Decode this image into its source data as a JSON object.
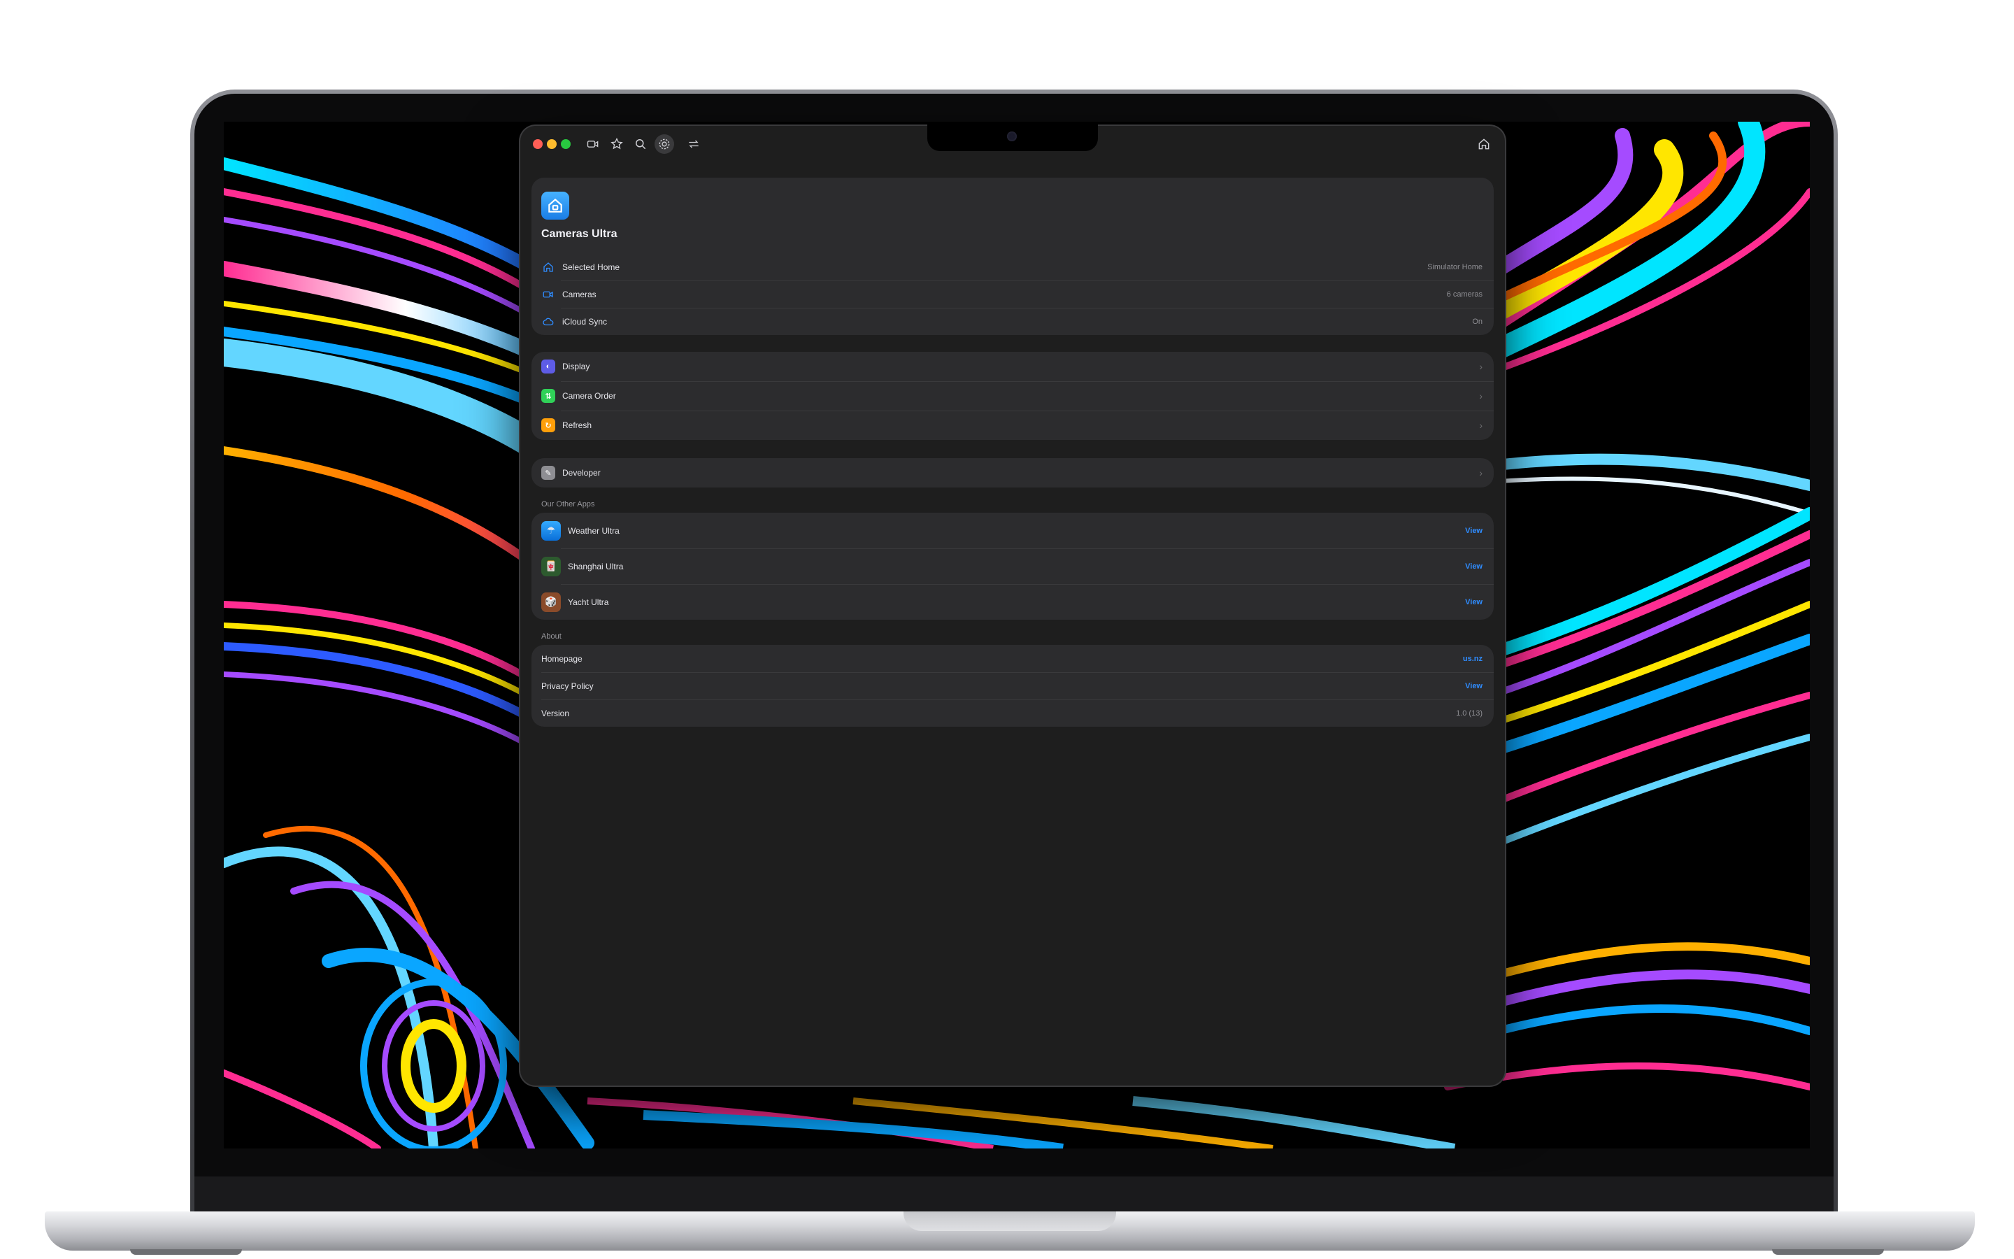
{
  "app": {
    "name": "Cameras Ultra",
    "accent": "#2f8cff"
  },
  "toolbar": {
    "icons": [
      "video-icon",
      "star-icon",
      "search-icon",
      "gear-icon",
      "swap-icon"
    ],
    "right_icon": "home-icon"
  },
  "summary": {
    "rows": [
      {
        "icon": "house-icon",
        "label": "Selected Home",
        "value": "Simulator Home"
      },
      {
        "icon": "video-icon",
        "label": "Cameras",
        "value": "6 cameras"
      },
      {
        "icon": "cloud-icon",
        "label": "iCloud Sync",
        "value": "On"
      }
    ]
  },
  "settings": {
    "rows": [
      {
        "icon": "display-icon",
        "label": "Display",
        "color": "#5e5ce6",
        "glyph": "◐"
      },
      {
        "icon": "order-icon",
        "label": "Camera Order",
        "color": "#30d158",
        "glyph": "⇅"
      },
      {
        "icon": "refresh-icon",
        "label": "Refresh",
        "color": "#ff9f0a",
        "glyph": "↻"
      }
    ],
    "chevron": "›"
  },
  "developer": {
    "label": "Developer",
    "color": "#8e8e93",
    "glyph": "✎"
  },
  "other_apps": {
    "title": "Our Other Apps",
    "items": [
      {
        "label": "Weather Ultra",
        "action": "View",
        "color": "#0a84ff",
        "glyph": "☂"
      },
      {
        "label": "Shanghai Ultra",
        "action": "View",
        "color": "#2d5a2e",
        "glyph": "🀄"
      },
      {
        "label": "Yacht Ultra",
        "action": "View",
        "color": "#8a4b2a",
        "glyph": "🎲"
      }
    ]
  },
  "about": {
    "title": "About",
    "rows": [
      {
        "label": "Homepage",
        "value": "us.nz",
        "is_link": true
      },
      {
        "label": "Privacy Policy",
        "value": "View",
        "is_link": true
      },
      {
        "label": "Version",
        "value": "1.0 (13)",
        "is_link": false
      }
    ]
  }
}
